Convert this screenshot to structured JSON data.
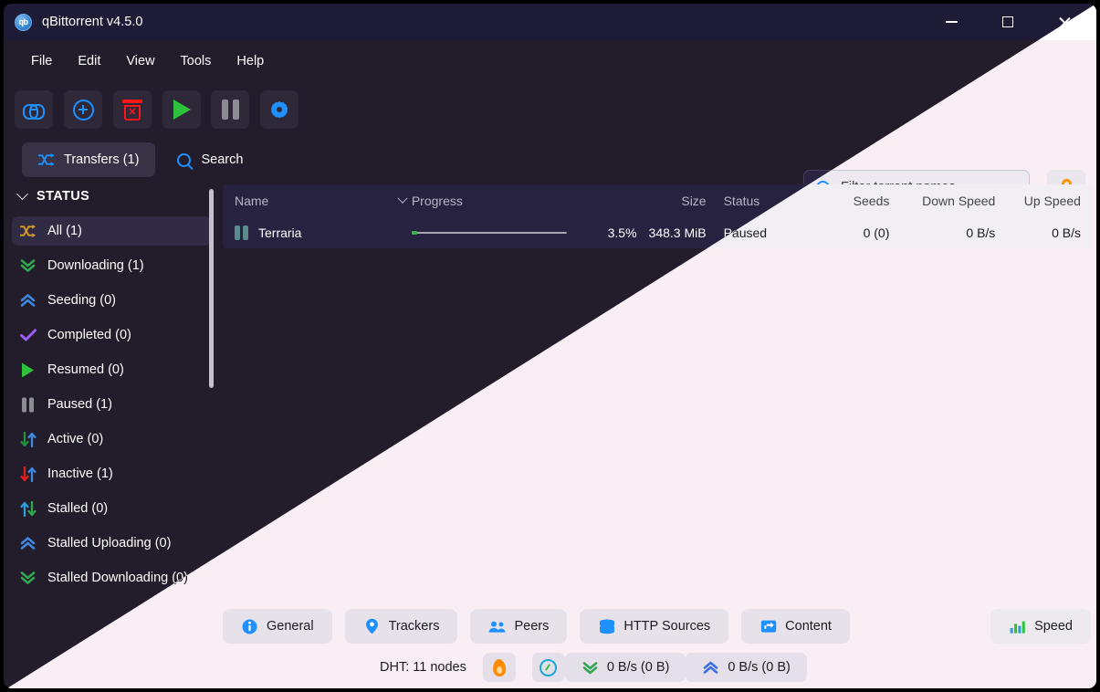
{
  "window": {
    "title": "qBittorrent v4.5.0",
    "logo_text": "qb",
    "minimize_label": "Minimize",
    "maximize_label": "Maximize",
    "close_label": "Close"
  },
  "menu": {
    "items": [
      "File",
      "Edit",
      "View",
      "Tools",
      "Help"
    ]
  },
  "toolbar": {
    "buttons": [
      {
        "name": "add-torrent-link",
        "icon": "link-icon",
        "color": "#1e90ff"
      },
      {
        "name": "add-torrent-file",
        "icon": "plus-circle-icon",
        "color": "#1e90ff"
      },
      {
        "name": "delete-torrent",
        "icon": "trash-icon",
        "color": "#ff1515"
      },
      {
        "name": "resume-torrent",
        "icon": "play-icon",
        "color": "#2fc23c"
      },
      {
        "name": "pause-torrent",
        "icon": "pause-icon",
        "color": "#8b8b94"
      },
      {
        "name": "preferences",
        "icon": "gear-icon",
        "color": "#1e90ff"
      }
    ]
  },
  "filter": {
    "placeholder": "Filter torrent names...",
    "value": "",
    "icon": "search-icon"
  },
  "lock": {
    "icon": "lock-icon",
    "color": "#ff9500",
    "label": "Lock"
  },
  "main_tabs": [
    {
      "label": "Transfers (1)",
      "icon": "shuffle-icon",
      "active": true
    },
    {
      "label": "Search",
      "icon": "search-icon",
      "active": false
    }
  ],
  "sidebar": {
    "header": "STATUS",
    "items": [
      {
        "label": "All (1)",
        "icon": "shuffle-icon",
        "color": "#d79c28",
        "selected": true
      },
      {
        "label": "Downloading (1)",
        "icon": "double-chevron-down-icon",
        "color": "#2fa84f",
        "selected": false
      },
      {
        "label": "Seeding (0)",
        "icon": "double-chevron-up-icon",
        "color": "#3d88e0",
        "selected": false
      },
      {
        "label": "Completed (0)",
        "icon": "check-icon",
        "color": "#9b5cf6",
        "selected": false
      },
      {
        "label": "Resumed (0)",
        "icon": "play-icon",
        "color": "#2fc23c",
        "selected": false
      },
      {
        "label": "Paused (1)",
        "icon": "pause-icon",
        "color": "#8b8b94",
        "selected": false
      },
      {
        "label": "Active (0)",
        "icon": "down-up-arrows-icon",
        "color": "#1f8f3d",
        "selected": false
      },
      {
        "label": "Inactive (1)",
        "icon": "down-up-arrows-icon",
        "color": "#e02020",
        "selected": false
      },
      {
        "label": "Stalled (0)",
        "icon": "up-down-arrows-icon",
        "color": "#2f9ed8",
        "selected": false
      },
      {
        "label": "Stalled Uploading (0)",
        "icon": "double-chevron-up-icon",
        "color": "#3d88e0",
        "selected": false
      },
      {
        "label": "Stalled Downloading (0)",
        "icon": "double-chevron-down-icon",
        "color": "#2fa84f",
        "selected": false
      }
    ]
  },
  "table": {
    "columns": [
      "Name",
      "Progress",
      "Size",
      "Status",
      "Seeds",
      "Down Speed",
      "Up Speed"
    ],
    "sort_column": "Name",
    "sort_direction": "descending",
    "rows": [
      {
        "name": "Terraria",
        "state_icon": "pause-icon",
        "progress_percent": 3.5,
        "progress_label": "3.5%",
        "size": "348.3 MiB",
        "status": "Paused",
        "seeds": "0 (0)",
        "down_speed": "0 B/s",
        "up_speed": "0 B/s"
      }
    ]
  },
  "bottom_tabs": [
    {
      "label": "General",
      "icon": "info-icon",
      "color": "#1e90ff",
      "active": false
    },
    {
      "label": "Trackers",
      "icon": "pin-icon",
      "color": "#1e90ff",
      "active": false
    },
    {
      "label": "Peers",
      "icon": "people-icon",
      "color": "#1e90ff",
      "active": false
    },
    {
      "label": "HTTP Sources",
      "icon": "database-icon",
      "color": "#1e90ff",
      "active": false
    },
    {
      "label": "Content",
      "icon": "folder-icon",
      "color": "#1e90ff",
      "active": false
    },
    {
      "label": "Speed",
      "icon": "bar-chart-icon",
      "color": "#2fc23c",
      "active": true
    }
  ],
  "status_bar": {
    "dht": "DHT: 11 nodes",
    "buttons": [
      {
        "name": "alt-speed-toggle",
        "icon": "flame-icon",
        "color": "#ff8c00"
      },
      {
        "name": "speed-limit-toggle",
        "icon": "speedometer-icon",
        "color": "#1aa8d8"
      }
    ],
    "download": {
      "icon": "double-chevron-down-icon",
      "color": "#2fa84f",
      "text": "0 B/s (0 B)"
    },
    "upload": {
      "icon": "double-chevron-up-icon",
      "color": "#3d6fe0",
      "text": "0 B/s (0 B)"
    }
  }
}
